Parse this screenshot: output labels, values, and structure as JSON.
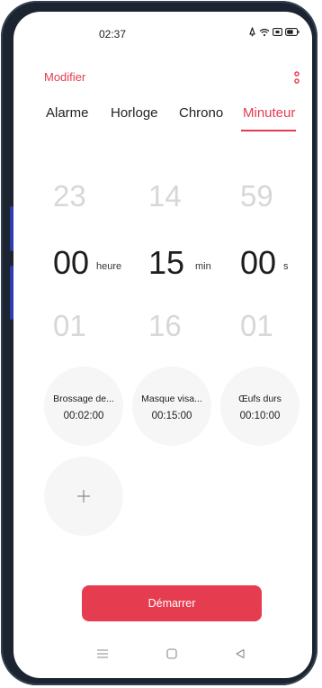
{
  "status_bar": {
    "time": "02:37",
    "icons": [
      "alarm-icon",
      "wifi-icon",
      "sim-icon",
      "battery-icon"
    ]
  },
  "header": {
    "modifier_label": "Modifier",
    "more_icon": "more-vertical-icon"
  },
  "tabs": [
    {
      "label": "Alarme",
      "active": false
    },
    {
      "label": "Horloge",
      "active": false
    },
    {
      "label": "Chrono",
      "active": false
    },
    {
      "label": "Minuteur",
      "active": true
    }
  ],
  "picker": {
    "hours": {
      "prev": "23",
      "current": "00",
      "next": "01",
      "unit": "heure"
    },
    "minutes": {
      "prev": "14",
      "current": "15",
      "next": "16",
      "unit": "min"
    },
    "seconds": {
      "prev": "59",
      "current": "00",
      "next": "01",
      "unit": "s"
    }
  },
  "presets": [
    {
      "name": "Brossage de...",
      "time": "00:02:00"
    },
    {
      "name": "Masque visa...",
      "time": "00:15:00"
    },
    {
      "name": "Œufs durs",
      "time": "00:10:00"
    }
  ],
  "add_preset_icon": "plus-icon",
  "start_button": {
    "label": "Démarrer"
  },
  "navbar": {
    "icons": [
      "menu-icon",
      "home-icon",
      "back-icon"
    ]
  },
  "colors": {
    "accent": "#e43c4f",
    "button": "#e63c4f",
    "preset_bg": "#f6f6f6"
  }
}
